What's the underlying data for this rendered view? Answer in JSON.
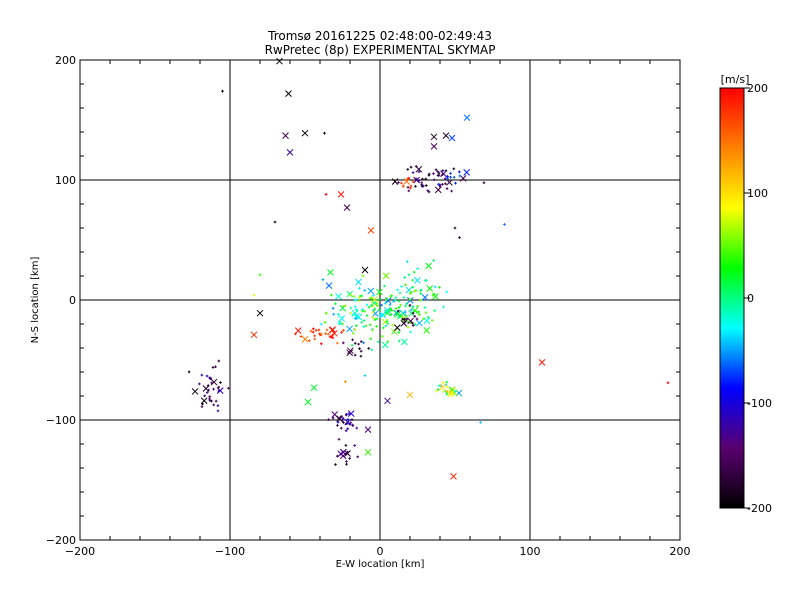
{
  "chart_data": {
    "type": "scatter",
    "title": [
      "Tromsø 20161225 02:48:00-02:49:43",
      "RwPretec (8p) EXPERIMENTAL SKYMAP"
    ],
    "xlabel": "E-W location [km]",
    "ylabel": "N-S location [km]",
    "xlim": [
      -200,
      200
    ],
    "ylim": [
      -200,
      200
    ],
    "xticks": [
      -200,
      -100,
      0,
      100,
      200
    ],
    "yticks": [
      -200,
      -100,
      0,
      100,
      200
    ],
    "grid": true,
    "colorbar": {
      "label": "[m/s]",
      "min": -200,
      "max": 200,
      "ticks": [
        200,
        100,
        0,
        -100,
        -200
      ],
      "colors": [
        "#000000",
        "#5a0070",
        "#0000ff",
        "#00ffff",
        "#00ff00",
        "#ffff00",
        "#ff8000",
        "#ff0000"
      ]
    },
    "clusters": [
      {
        "cx": 0,
        "cy": -10,
        "sx": 18,
        "sy": 12,
        "n": 170,
        "vmin": -60,
        "vmax": 80
      },
      {
        "cx": 25,
        "cy": 5,
        "sx": 12,
        "sy": 12,
        "n": 40,
        "vmin": -40,
        "vmax": 60
      },
      {
        "cx": -40,
        "cy": -28,
        "sx": 8,
        "sy": 4,
        "n": 30,
        "vmin": 140,
        "vmax": 200
      },
      {
        "cx": 30,
        "cy": 100,
        "sx": 12,
        "sy": 6,
        "n": 50,
        "vmin": -200,
        "vmax": -120
      },
      {
        "cx": 48,
        "cy": 104,
        "sx": 4,
        "sy": 3,
        "n": 10,
        "vmin": -90,
        "vmax": -60
      },
      {
        "cx": 18,
        "cy": 98,
        "sx": 4,
        "sy": 3,
        "n": 10,
        "vmin": 150,
        "vmax": 200
      },
      {
        "cx": -113,
        "cy": -70,
        "sx": 5,
        "sy": 10,
        "n": 35,
        "vmin": -200,
        "vmax": -110
      },
      {
        "cx": -25,
        "cy": -100,
        "sx": 4,
        "sy": 4,
        "n": 30,
        "vmin": -180,
        "vmax": -100
      },
      {
        "cx": -25,
        "cy": -130,
        "sx": 5,
        "sy": 6,
        "n": 15,
        "vmin": -200,
        "vmax": -130
      },
      {
        "cx": 46,
        "cy": -76,
        "sx": 4,
        "sy": 4,
        "n": 25,
        "vmin": -80,
        "vmax": 120
      },
      {
        "cx": -15,
        "cy": -40,
        "sx": 6,
        "sy": 4,
        "n": 12,
        "vmin": -200,
        "vmax": -140
      },
      {
        "cx": 20,
        "cy": -15,
        "sx": 6,
        "sy": 5,
        "n": 15,
        "vmin": -200,
        "vmax": -150
      }
    ],
    "points": [
      {
        "x": -105,
        "y": 174,
        "v": -200,
        "m": "+"
      },
      {
        "x": -67,
        "y": 199,
        "v": -200,
        "m": "x"
      },
      {
        "x": -61,
        "y": 172,
        "v": -200,
        "m": "x"
      },
      {
        "x": -63,
        "y": 137,
        "v": -160,
        "m": "x"
      },
      {
        "x": -50,
        "y": 139,
        "v": -200,
        "m": "x"
      },
      {
        "x": -37,
        "y": 139,
        "v": -200,
        "m": "+"
      },
      {
        "x": -60,
        "y": 123,
        "v": -120,
        "m": "x"
      },
      {
        "x": -36,
        "y": 88,
        "v": 200,
        "m": "+"
      },
      {
        "x": -26,
        "y": 88,
        "v": 190,
        "m": "x"
      },
      {
        "x": -22,
        "y": 77,
        "v": -160,
        "m": "x"
      },
      {
        "x": -70,
        "y": 65,
        "v": -200,
        "m": "+"
      },
      {
        "x": -6,
        "y": 58,
        "v": 170,
        "m": "x"
      },
      {
        "x": 50,
        "y": 60,
        "v": -180,
        "m": "+"
      },
      {
        "x": 53,
        "y": 52,
        "v": -180,
        "m": "+"
      },
      {
        "x": 83,
        "y": 63,
        "v": -60,
        "m": "+"
      },
      {
        "x": -84,
        "y": 4,
        "v": 80,
        "m": "+"
      },
      {
        "x": -80,
        "y": 21,
        "v": 40,
        "m": "+"
      },
      {
        "x": -33,
        "y": 23,
        "v": 20,
        "m": "x"
      },
      {
        "x": -34,
        "y": 12,
        "v": -60,
        "m": "x"
      },
      {
        "x": -10,
        "y": 25,
        "v": -200,
        "m": "x"
      },
      {
        "x": -80,
        "y": -11,
        "v": -200,
        "m": "x"
      },
      {
        "x": -84,
        "y": -29,
        "v": 180,
        "m": "x"
      },
      {
        "x": -44,
        "y": -73,
        "v": 20,
        "m": "x"
      },
      {
        "x": -48,
        "y": -85,
        "v": 20,
        "m": "x"
      },
      {
        "x": -23,
        "y": -68,
        "v": 140,
        "m": "+"
      },
      {
        "x": -10,
        "y": -63,
        "v": -40,
        "m": "+"
      },
      {
        "x": 5,
        "y": -84,
        "v": -130,
        "m": "x"
      },
      {
        "x": 20,
        "y": -79,
        "v": 120,
        "m": "x"
      },
      {
        "x": -8,
        "y": -108,
        "v": -130,
        "m": "x"
      },
      {
        "x": -8,
        "y": -127,
        "v": 40,
        "m": "x"
      },
      {
        "x": 67,
        "y": -102,
        "v": -40,
        "m": "+"
      },
      {
        "x": 49,
        "y": -147,
        "v": 180,
        "m": "x"
      },
      {
        "x": 108,
        "y": -52,
        "v": 190,
        "m": "x"
      },
      {
        "x": 192,
        "y": -69,
        "v": 200,
        "m": "+"
      },
      {
        "x": 58,
        "y": 152,
        "v": -60,
        "m": "x"
      },
      {
        "x": 44,
        "y": 137,
        "v": -180,
        "m": "x"
      },
      {
        "x": 36,
        "y": 136,
        "v": -180,
        "m": "x"
      },
      {
        "x": 48,
        "y": 135,
        "v": -70,
        "m": "x"
      },
      {
        "x": 36,
        "y": 128,
        "v": -150,
        "m": "x"
      }
    ]
  }
}
